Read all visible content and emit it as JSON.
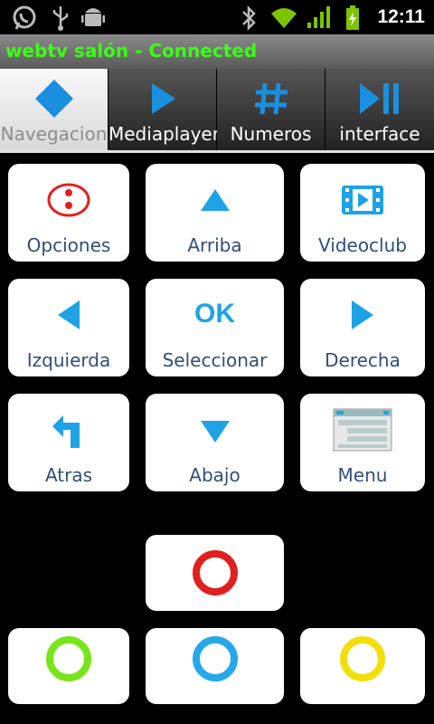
{
  "status_bar": {
    "time": "12:11",
    "icons": [
      "whatsapp-icon",
      "usb-icon",
      "android-debug-icon",
      "bluetooth-icon",
      "wifi-icon",
      "signal-icon",
      "battery-charging-icon"
    ]
  },
  "title_bar": {
    "text": "webtv salón - Connected",
    "color": "#39ff14"
  },
  "tabs": [
    {
      "label": "Navegacion",
      "icon": "diamond-icon",
      "active": true
    },
    {
      "label": "Mediaplayer",
      "icon": "play-icon",
      "active": false
    },
    {
      "label": "Numeros",
      "icon": "hash-icon",
      "active": false
    },
    {
      "label": "interface",
      "icon": "play-pause-icon",
      "active": false
    }
  ],
  "buttons": {
    "opciones": "Opciones",
    "arriba": "Arriba",
    "videoclub": "Videoclub",
    "izquierda": "Izquierda",
    "ok_text": "OK",
    "seleccionar": "Seleccionar",
    "derecha": "Derecha",
    "atras": "Atras",
    "abajo": "Abajo",
    "menu": "Menu"
  },
  "color_buttons": {
    "red": "#e0201f",
    "green": "#77e51a",
    "blue": "#27a8e8",
    "yellow": "#f3de0b"
  },
  "colors": {
    "accent": "#1da3e5",
    "label": "#2f4f7a"
  }
}
